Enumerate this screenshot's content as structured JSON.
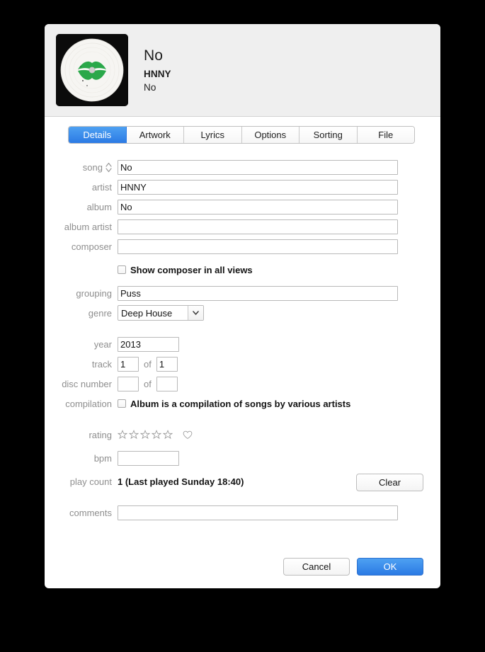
{
  "window": {
    "title": "No",
    "artist": "HNNY",
    "album": "No",
    "artwork_alt": "vinyl-record-green-lips"
  },
  "tabs": [
    {
      "label": "Details",
      "active": true
    },
    {
      "label": "Artwork",
      "active": false
    },
    {
      "label": "Lyrics",
      "active": false
    },
    {
      "label": "Options",
      "active": false
    },
    {
      "label": "Sorting",
      "active": false
    },
    {
      "label": "File",
      "active": false
    }
  ],
  "fields": {
    "song": {
      "label": "song",
      "value": "No",
      "placeholder": ""
    },
    "artist": {
      "label": "artist",
      "value": "HNNY",
      "placeholder": ""
    },
    "album": {
      "label": "album",
      "value": "No",
      "placeholder": ""
    },
    "album_artist": {
      "label": "album artist",
      "value": "",
      "placeholder": ""
    },
    "composer": {
      "label": "composer",
      "value": "",
      "placeholder": ""
    },
    "show_composer": {
      "label": "Show composer in all views",
      "checked": false
    },
    "grouping": {
      "label": "grouping",
      "value": "Puss",
      "placeholder": ""
    },
    "genre": {
      "label": "genre",
      "value": "Deep House"
    },
    "year": {
      "label": "year",
      "value": "2013",
      "placeholder": ""
    },
    "track": {
      "label": "track",
      "value": "1",
      "of_text": "of",
      "total": "1"
    },
    "disc": {
      "label": "disc number",
      "value": "",
      "of_text": "of",
      "total": ""
    },
    "compilation": {
      "label": "compilation",
      "checkbox_label": "Album is a compilation of songs by various artists",
      "checked": false
    },
    "rating": {
      "label": "rating",
      "stars": 5,
      "filled": 0,
      "loved": false
    },
    "bpm": {
      "label": "bpm",
      "value": "",
      "placeholder": ""
    },
    "play_count": {
      "label": "play count",
      "value": "1 (Last played Sunday 18:40)",
      "clear_label": "Clear"
    },
    "comments": {
      "label": "comments",
      "value": "",
      "placeholder": ""
    }
  },
  "footer": {
    "cancel_label": "Cancel",
    "ok_label": "OK"
  },
  "colors": {
    "accent_blue_top": "#4ea1f2",
    "accent_blue_bottom": "#2b7ae4",
    "header_bg": "#efefef",
    "label_gray": "#8e8e8e",
    "field_border": "#b9b9b9",
    "artwork_green": "#2aa84a"
  }
}
